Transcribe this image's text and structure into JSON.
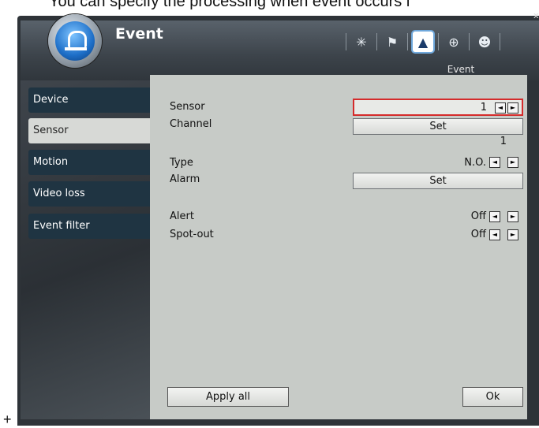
{
  "caption": "You can specify the processing when event occurs i",
  "plus_mark": "+",
  "close_glyph": "x",
  "app": {
    "title": "Event",
    "subtitle": "Event"
  },
  "toolbar": {
    "icons": [
      "settings-icon",
      "flag-icon",
      "event-bell-icon",
      "network-globe-icon",
      "users-icon"
    ],
    "active_index": 2
  },
  "sidebar": {
    "items": [
      {
        "label": "Device"
      },
      {
        "label": "Sensor"
      },
      {
        "label": "Motion"
      },
      {
        "label": "Video loss"
      },
      {
        "label": "Event filter"
      }
    ],
    "selected": "Sensor"
  },
  "form": {
    "sensor": {
      "label": "Sensor",
      "value": "1"
    },
    "channel": {
      "label": "Channel",
      "button": "Set",
      "value": "1"
    },
    "type": {
      "label": "Type",
      "value": "N.O."
    },
    "alarm": {
      "label": "Alarm",
      "button": "Set"
    },
    "alert": {
      "label": "Alert",
      "value": "Off"
    },
    "spot_out": {
      "label": "Spot-out",
      "value": "Off"
    }
  },
  "arrows": {
    "left": "◄",
    "right": "►"
  },
  "buttons": {
    "apply_all": "Apply all",
    "ok": "Ok"
  },
  "colors": {
    "focus_border": "#d42b2b",
    "sidebar_item": "#1f3442",
    "selected_item": "#d7d9d6",
    "panel": "#c7cbc7"
  }
}
